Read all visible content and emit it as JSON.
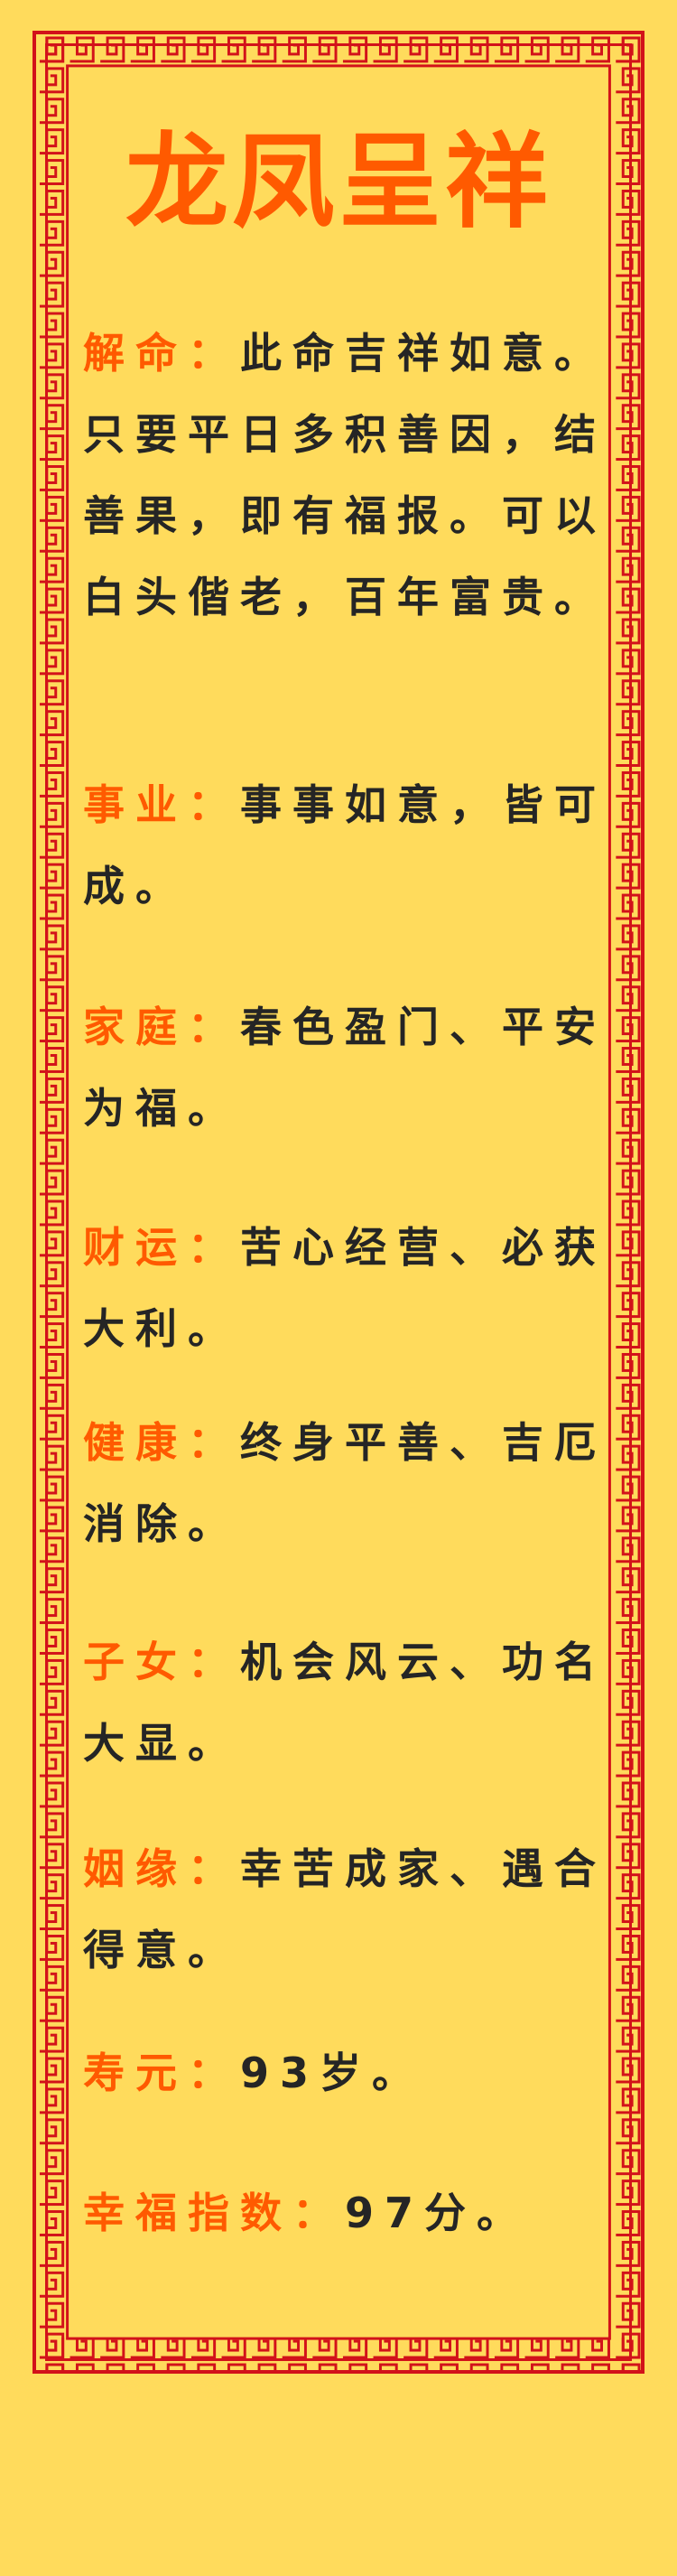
{
  "page": {
    "title": "龙凤呈祥"
  },
  "sections": [
    {
      "label": "解命：",
      "value": "此命吉祥如意。只要平日多积善因，结善果，即有福报。可以白头偕老，百年富贵。"
    },
    {
      "label": "事业：",
      "value": "事事如意，皆可成。"
    },
    {
      "label": "家庭：",
      "value": "春色盈门、平安为福。"
    },
    {
      "label": "财运：",
      "value": "苦心经营、必获大利。"
    },
    {
      "label": "健康：",
      "value": "终身平善、吉厄消除。"
    },
    {
      "label": "子女：",
      "value": "机会风云、功名大显。"
    },
    {
      "label": "姻缘：",
      "value": "幸苦成家、遇合得意。"
    },
    {
      "label": "寿元：",
      "value": "93岁。"
    },
    {
      "label": "幸福指数：",
      "value": "97分。"
    }
  ],
  "colors": {
    "background": "#ffdb5c",
    "border": "#d2121a",
    "accent": "#ff5a00",
    "text": "#252525"
  }
}
